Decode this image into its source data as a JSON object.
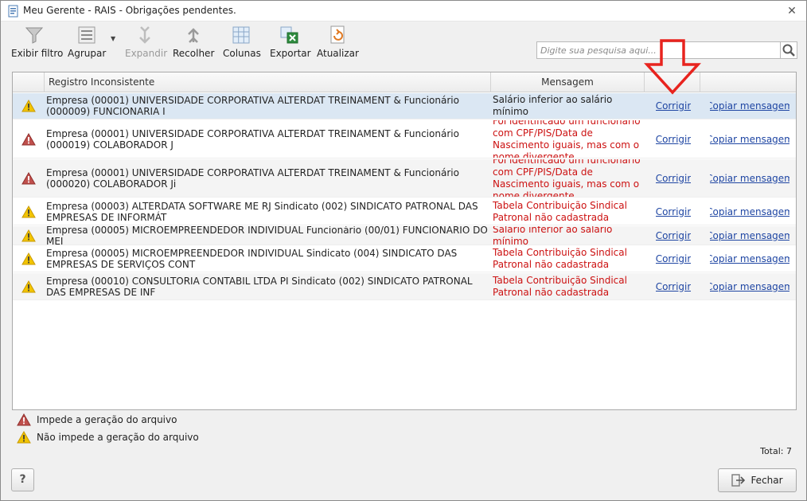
{
  "window": {
    "title": "Meu Gerente - RAIS - Obrigações pendentes.",
    "close_glyph": "✕"
  },
  "toolbar": {
    "filter": "Exibir filtro",
    "group": "Agrupar",
    "expand": "Expandir",
    "collapse": "Recolher",
    "columns": "Colunas",
    "export": "Exportar",
    "refresh": "Atualizar"
  },
  "search": {
    "placeholder": "Digite sua pesquisa aqui..."
  },
  "grid": {
    "headers": {
      "record": "Registro Inconsistente",
      "message": "Mensagem"
    },
    "rows": [
      {
        "severity": "warning",
        "record": "Empresa (00001) UNIVERSIDADE CORPORATIVA ALTERDAT TREINAMENT & Funcionário (000009) FUNCIONARIA I",
        "message": "Salário inferior ao salário mínimo",
        "fix": "Corrigir",
        "copy": "Copiar mensagem"
      },
      {
        "severity": "error",
        "record": "Empresa (00001) UNIVERSIDADE CORPORATIVA ALTERDAT TREINAMENT & Funcionário (000019) COLABORADOR J",
        "message": "Foi identificado um funcionário com CPF/PIS/Data de Nascimento iguais, mas com o nome divergente",
        "fix": "Corrigir",
        "copy": "Copiar mensagem"
      },
      {
        "severity": "error",
        "record": "Empresa (00001) UNIVERSIDADE CORPORATIVA ALTERDAT TREINAMENT & Funcionário (000020) COLABORADOR Ji",
        "message": "Foi identificado um funcionário com CPF/PIS/Data de Nascimento iguais, mas com o nome divergente",
        "fix": "Corrigir",
        "copy": "Copiar mensagem"
      },
      {
        "severity": "warning",
        "record": "Empresa (00003) ALTERDATA SOFTWARE ME RJ Sindicato (002) SINDICATO PATRONAL DAS EMPRESAS DE INFORMÁT",
        "message": "Tabela Contribuição Sindical Patronal não cadastrada",
        "fix": "Corrigir",
        "copy": "Copiar mensagem"
      },
      {
        "severity": "warning",
        "record": "Empresa (00005) MICROEMPREENDEDOR INDIVIDUAL Funcionário (00/01) FUNCIONÁRIO DO MEI",
        "message": "Salário inferior ao salário mínimo",
        "fix": "Corrigir",
        "copy": "Copiar mensagem"
      },
      {
        "severity": "warning",
        "record": "Empresa (00005) MICROEMPREENDEDOR INDIVIDUAL Sindicato (004) SINDICATO DAS EMPRESAS DE SERVIÇOS CONT",
        "message": "Tabela Contribuição Sindical Patronal não cadastrada",
        "fix": "Corrigir",
        "copy": "Copiar mensagem"
      },
      {
        "severity": "warning",
        "record": "Empresa (00010) CONSULTORIA CONTABIL LTDA  PI Sindicato (002) SINDICATO PATRONAL DAS EMPRESAS DE INF",
        "message": "Tabela Contribuição Sindical Patronal não cadastrada",
        "fix": "Corrigir",
        "copy": "Copiar mensagem"
      }
    ]
  },
  "legend": {
    "error": "Impede a geração do arquivo",
    "warning": "Não impede a geração do arquivo"
  },
  "total": "Total: 7",
  "buttons": {
    "help": "?",
    "close": "Fechar"
  },
  "colors": {
    "error": "#c0504d",
    "warning": "#f2c400",
    "error_text": "#cc1111",
    "link": "#1f46a3",
    "arrow": "#e8231e",
    "selected_row": "#dbe7f3"
  }
}
